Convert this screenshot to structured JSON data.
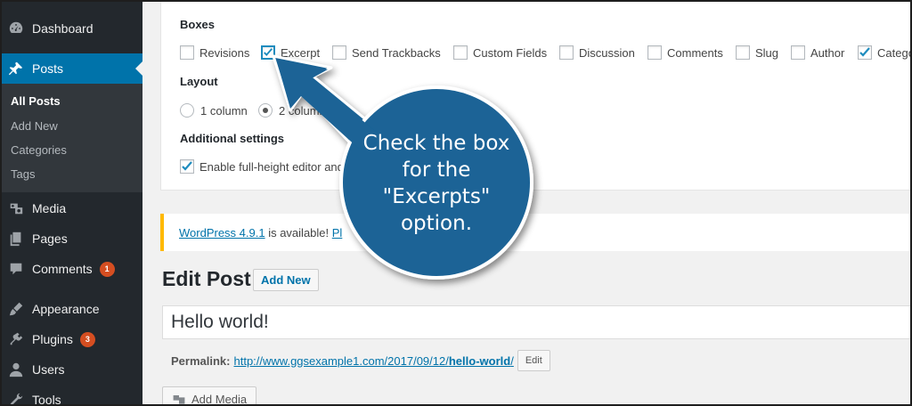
{
  "sidebar": {
    "items": [
      {
        "label": "Dashboard",
        "icon": "dashboard-icon"
      },
      {
        "label": "Posts",
        "icon": "pushpin-icon"
      },
      {
        "label": "Media",
        "icon": "media-icon"
      },
      {
        "label": "Pages",
        "icon": "pages-icon"
      },
      {
        "label": "Comments",
        "icon": "comment-icon",
        "badge": "1"
      },
      {
        "label": "Appearance",
        "icon": "paintbrush-icon"
      },
      {
        "label": "Plugins",
        "icon": "plug-icon",
        "badge": "3"
      },
      {
        "label": "Users",
        "icon": "user-icon"
      },
      {
        "label": "Tools",
        "icon": "wrench-icon"
      }
    ],
    "submenu": [
      "All Posts",
      "Add New",
      "Categories",
      "Tags"
    ]
  },
  "screen_options": {
    "boxes_title": "Boxes",
    "boxes": [
      {
        "label": "Revisions",
        "checked": false
      },
      {
        "label": "Excerpt",
        "checked": true
      },
      {
        "label": "Send Trackbacks",
        "checked": false
      },
      {
        "label": "Custom Fields",
        "checked": false
      },
      {
        "label": "Discussion",
        "checked": false
      },
      {
        "label": "Comments",
        "checked": false
      },
      {
        "label": "Slug",
        "checked": false
      },
      {
        "label": "Author",
        "checked": false
      },
      {
        "label": "Catego",
        "checked": true
      }
    ],
    "layout_title": "Layout",
    "layout_options": [
      {
        "label": "1 column",
        "selected": false
      },
      {
        "label": "2 column",
        "selected": true
      }
    ],
    "additional_title": "Additional settings",
    "additional_option": {
      "label": "Enable full-height editor and",
      "checked": true
    }
  },
  "notice": {
    "link": "WordPress 4.9.1",
    "text": " is available! ",
    "link2": "Pl"
  },
  "edit_post": {
    "title": "Edit Post",
    "add_new_label": "Add New",
    "post_title_value": "Hello world!",
    "permalink_label": "Permalink:",
    "permalink_base": "http://www.ggsexample1.com/2017/09/12/",
    "permalink_slug": "hello-world",
    "permalink_trailing": "/",
    "edit_label": "Edit",
    "add_media_label": "Add Media"
  },
  "callout": {
    "lines": [
      "Check the box",
      "for the",
      "\"Excerpts\"",
      "option."
    ],
    "color": "#1a6496"
  },
  "colors": {
    "sidebar_bg": "#23282d",
    "active_blue": "#0073aa",
    "notice_yellow": "#ffb900"
  }
}
